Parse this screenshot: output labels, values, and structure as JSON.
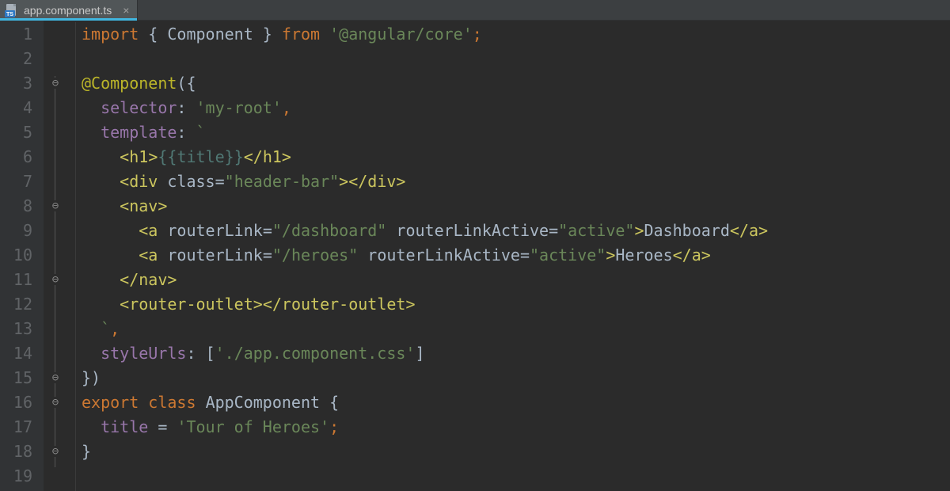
{
  "tab": {
    "filename": "app.component.ts",
    "icon_name": "typescript-file-icon",
    "icon_badge": "TS"
  },
  "gutter": {
    "lines": [
      "1",
      "2",
      "3",
      "4",
      "5",
      "6",
      "7",
      "8",
      "9",
      "10",
      "11",
      "12",
      "13",
      "14",
      "15",
      "16",
      "17",
      "18",
      "19"
    ]
  },
  "code": {
    "l1": {
      "kw_import": "import",
      "br_open": "{ ",
      "id": "Component",
      "br_close": " }",
      "kw_from": "from",
      "str": "'@angular/core'",
      "semi": ";"
    },
    "l3": {
      "decor": "@Component",
      "paren_open": "(",
      "brace_open": "{"
    },
    "l4": {
      "prop": "selector",
      "colon": ":",
      "str": "'my-root'",
      "comma": ","
    },
    "l5": {
      "prop": "template",
      "colon": ":",
      "backtick": "`"
    },
    "l6": {
      "open": "<",
      "tag": "h1",
      "gt": ">",
      "expr": "{{title}}",
      "close_open": "</",
      "tag2": "h1",
      "gt2": ">"
    },
    "l7": {
      "open": "<",
      "tag": "div",
      "sp": " ",
      "attr": "class",
      "eq": "=",
      "val": "\"header-bar\"",
      "gt": ">",
      "close_open": "</",
      "tag2": "div",
      "gt2": ">"
    },
    "l8": {
      "open": "<",
      "tag": "nav",
      "gt": ">"
    },
    "l9": {
      "open": "<",
      "tag": "a",
      "sp": " ",
      "attr1": "routerLink",
      "eq1": "=",
      "val1": "\"/dashboard\"",
      "sp2": " ",
      "attr2": "routerLinkActive",
      "eq2": "=",
      "val2": "\"active\"",
      "gt": ">",
      "text": "Dashboard",
      "close_open": "</",
      "tag2": "a",
      "gt2": ">"
    },
    "l10": {
      "open": "<",
      "tag": "a",
      "sp": " ",
      "attr1": "routerLink",
      "eq1": "=",
      "val1": "\"/heroes\"",
      "sp2": " ",
      "attr2": "routerLinkActive",
      "eq2": "=",
      "val2": "\"active\"",
      "gt": ">",
      "text": "Heroes",
      "close_open": "</",
      "tag2": "a",
      "gt2": ">"
    },
    "l11": {
      "close_open": "</",
      "tag": "nav",
      "gt": ">"
    },
    "l12": {
      "open": "<",
      "tag": "router-outlet",
      "gt": ">",
      "close_open": "</",
      "tag2": "router-outlet",
      "gt2": ">"
    },
    "l13": {
      "backtick": "`",
      "comma": ","
    },
    "l14": {
      "prop": "styleUrls",
      "colon": ":",
      "arr_open": "[",
      "str": "'./app.component.css'",
      "arr_close": "]"
    },
    "l15": {
      "brace_close": "}",
      "paren_close": ")"
    },
    "l16": {
      "kw_export": "export",
      "kw_class": "class",
      "cls": "AppComponent",
      "brace_open": "{"
    },
    "l17": {
      "prop": "title",
      "eq": " = ",
      "str": "'Tour of Heroes'",
      "semi": ";"
    },
    "l18": {
      "brace_close": "}"
    }
  }
}
